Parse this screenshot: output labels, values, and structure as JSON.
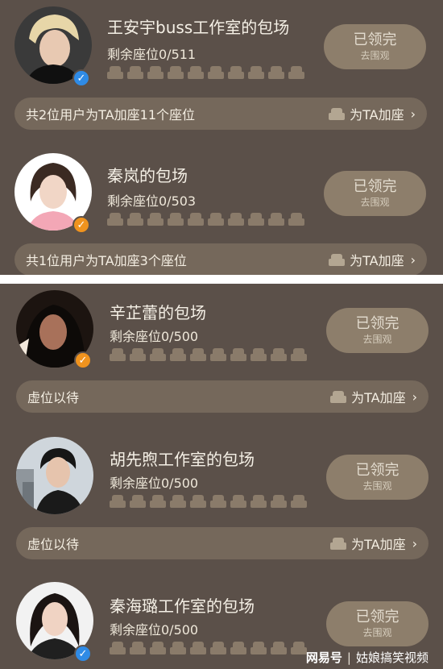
{
  "claimed_label": "已领完",
  "claimed_sub": "去围观",
  "add_seat_label": "为TA加座",
  "chevron": "›",
  "cards": [
    {
      "name": "王安宇buss工作室的包场",
      "seats": "剩余座位0/511",
      "badge": "✓",
      "footer": "共2位用户为TA加座11个座位"
    },
    {
      "name": "秦岚的包场",
      "seats": "剩余座位0/503",
      "badge": "✓",
      "footer": "共1位用户为TA加座3个座位"
    },
    {
      "name": "辛芷蕾的包场",
      "seats": "剩余座位0/500",
      "badge": "✓",
      "footer": "虚位以待"
    },
    {
      "name": "胡先煦工作室的包场",
      "seats": "剩余座位0/500",
      "badge": "✓",
      "footer": "虚位以待"
    },
    {
      "name": "秦海璐工作室的包场",
      "seats": "剩余座位0/500",
      "badge": "✓",
      "footer": ""
    }
  ],
  "watermark": {
    "logo": "网易号",
    "separator": "|",
    "account": "姑娘搞笑视频"
  },
  "colors": {
    "panel_bg": "#5b5049",
    "bar_bg": "#75685b",
    "button_bg": "#8d7e6b",
    "verify_blue": "#2f8be6",
    "verify_orange": "#f0931e"
  }
}
